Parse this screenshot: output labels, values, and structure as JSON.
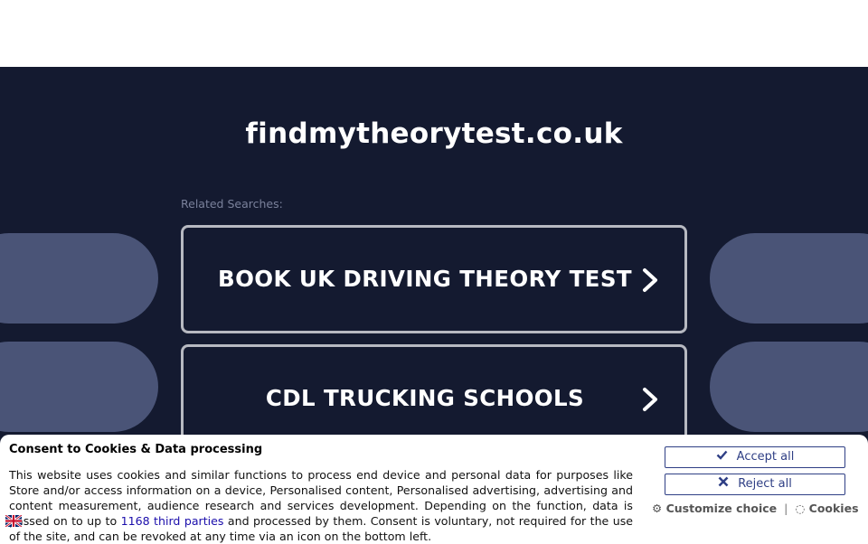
{
  "page": {
    "domain": "findmytheorytest.co.uk",
    "related_label": "Related Searches:",
    "searches": [
      {
        "label": "BOOK UK DRIVING THEORY TEST"
      },
      {
        "label": "CDL TRUCKING SCHOOLS"
      }
    ]
  },
  "consent": {
    "title": "Consent to Cookies & Data processing",
    "text_before": "This website uses cookies and similar functions to process end device and personal data for purposes like Store and/or access information on a device, Personalised content, Personalised advertising, advertising and content measurement, audience research and services development. Depending on the function, data is passed on to up to ",
    "third_parties_link": "1168 third parties",
    "text_after": " and processed by them. Consent is voluntary, not required for the use of the site, and can be revoked at any time via an icon on the bottom left.",
    "accept_label": "Accept all",
    "reject_label": "Reject all",
    "customize_label": "Customize choice",
    "cookies_label": "Cookies",
    "separator": "|"
  },
  "colors": {
    "background": "#141a30",
    "blob": "#4a5477",
    "button_border": "#2f3f85",
    "link": "#1a0dab"
  },
  "icons": {
    "chevron": "chevron-right-icon",
    "accept": "check-icon",
    "reject": "x-icon",
    "customize": "gear-icon",
    "cookies": "cookie-icon",
    "flag": "uk-flag-icon"
  }
}
